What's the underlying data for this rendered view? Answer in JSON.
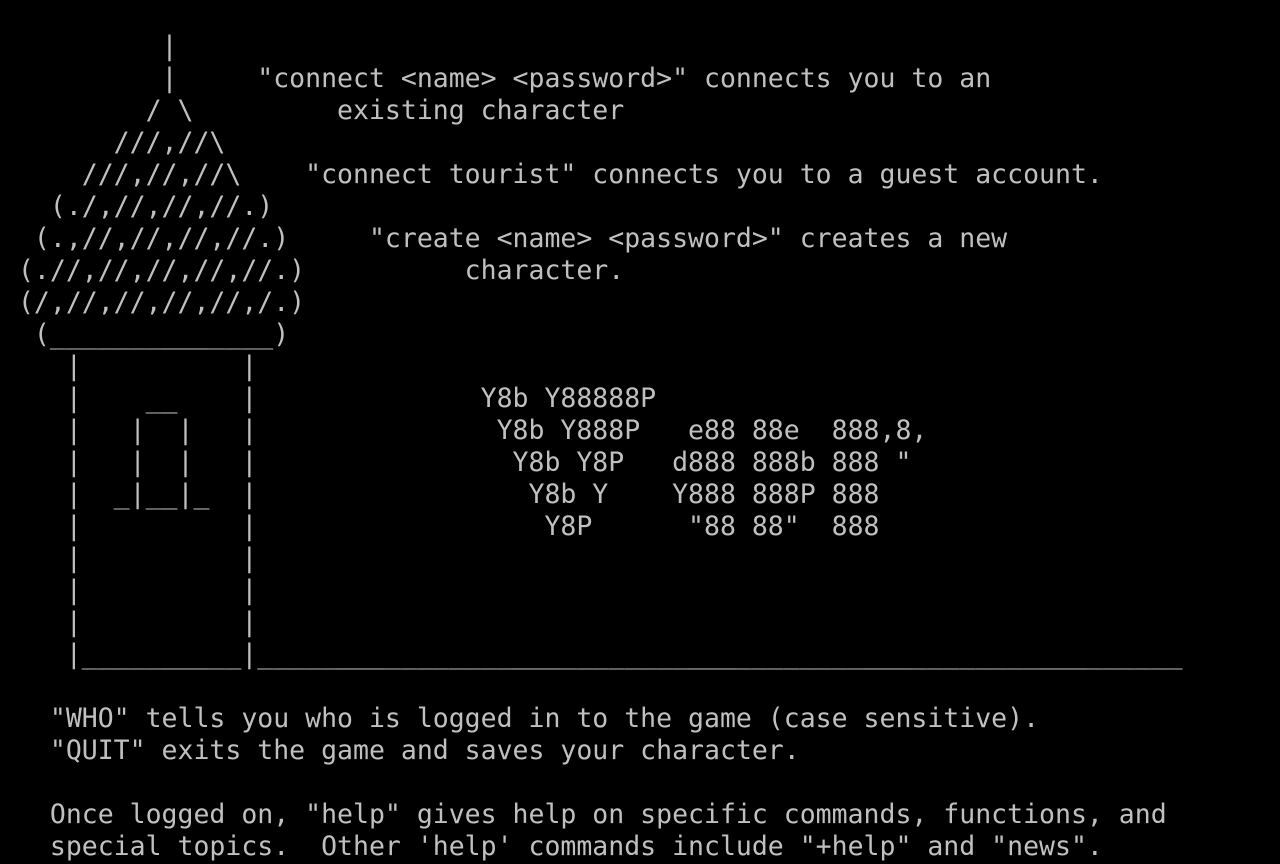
{
  "terminal": {
    "background_color": "#000000",
    "text_color": "#c0c0c0",
    "lines": [
      "          |",
      "          |     \"connect <name> <password>\" connects you to an",
      "         / \\         existing character",
      "       ///,//\\",
      "     ///,//,//\\    \"connect tourist\" connects you to a guest account.",
      "   (./,//,//,//.)",
      "  (.,//,//,//,//.)     \"create <name> <password>\" creates a new",
      " (.//,//,//,//,//.)          character.",
      " (/,//,//,//,//,/.)",
      "  (______________)",
      "    |          |",
      "    |    __    |              Y8b Y88888P",
      "    |   |  |   |               Y8b Y888P   e88 88e  888,8,",
      "    |   |  |   |                Y8b Y8P   d888 888b 888 \"",
      "    |  _|__|_  |                 Y8b Y    Y888 888P 888",
      "    |          |                  Y8P      \"88 88\"  888",
      "    |          |",
      "    |          |",
      "    |          |",
      "    |__________|__________________________________________________________",
      "",
      "   \"WHO\" tells you who is logged in to the game (case sensitive).",
      "   \"QUIT\" exits the game and saves your character.",
      "",
      "   Once logged on, \"help\" gives help on specific commands, functions, and",
      "   special topics.  Other 'help' commands include \"+help\" and \"news\"."
    ]
  }
}
